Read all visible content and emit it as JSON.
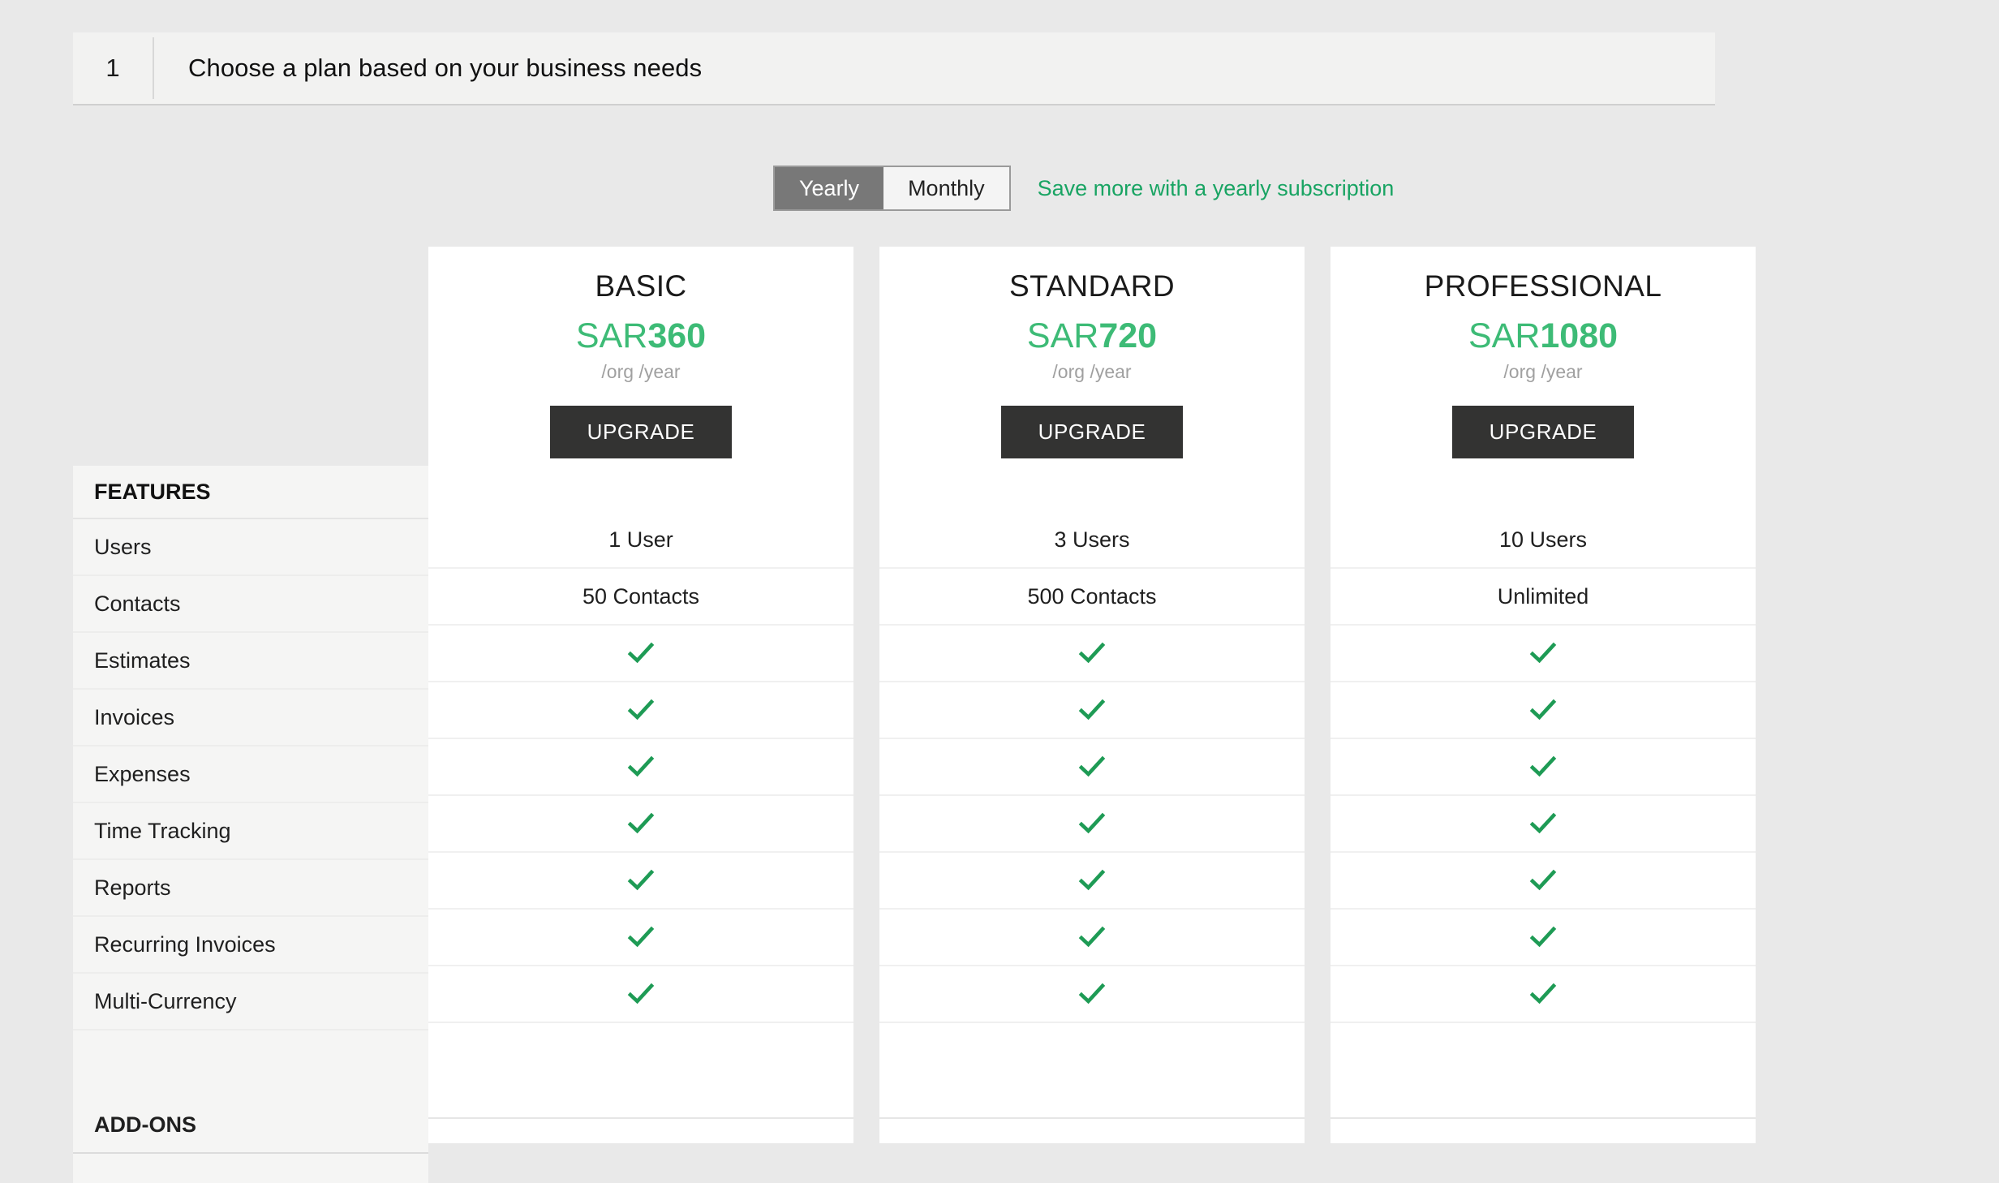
{
  "step": {
    "number": "1",
    "title": "Choose a plan based on your business needs"
  },
  "billing": {
    "options": [
      {
        "label": "Yearly",
        "active": true
      },
      {
        "label": "Monthly",
        "active": false
      }
    ],
    "save_note": "Save more with a yearly subscription",
    "save_note_color": "#19a463"
  },
  "sidebar": {
    "features_heading": "FEATURES",
    "features": [
      "Users",
      "Contacts",
      "Estimates",
      "Invoices",
      "Expenses",
      "Time Tracking",
      "Reports",
      "Recurring Invoices",
      "Multi-Currency"
    ],
    "addons_heading": "ADD-ONS"
  },
  "accent_color": "#3dbb76",
  "check_color": "#1e9b55",
  "cta_color": "#333332",
  "plans": [
    {
      "name": "BASIC",
      "currency": "SAR",
      "amount": "360",
      "period": "/org /year",
      "cta": "UPGRADE",
      "values": [
        "1 User",
        "50 Contacts",
        "check",
        "check",
        "check",
        "check",
        "check",
        "check",
        "check"
      ]
    },
    {
      "name": "STANDARD",
      "currency": "SAR",
      "amount": "720",
      "period": "/org /year",
      "cta": "UPGRADE",
      "values": [
        "3 Users",
        "500 Contacts",
        "check",
        "check",
        "check",
        "check",
        "check",
        "check",
        "check"
      ]
    },
    {
      "name": "PROFESSIONAL",
      "currency": "SAR",
      "amount": "1080",
      "period": "/org /year",
      "cta": "UPGRADE",
      "values": [
        "10 Users",
        "Unlimited",
        "check",
        "check",
        "check",
        "check",
        "check",
        "check",
        "check"
      ]
    }
  ]
}
